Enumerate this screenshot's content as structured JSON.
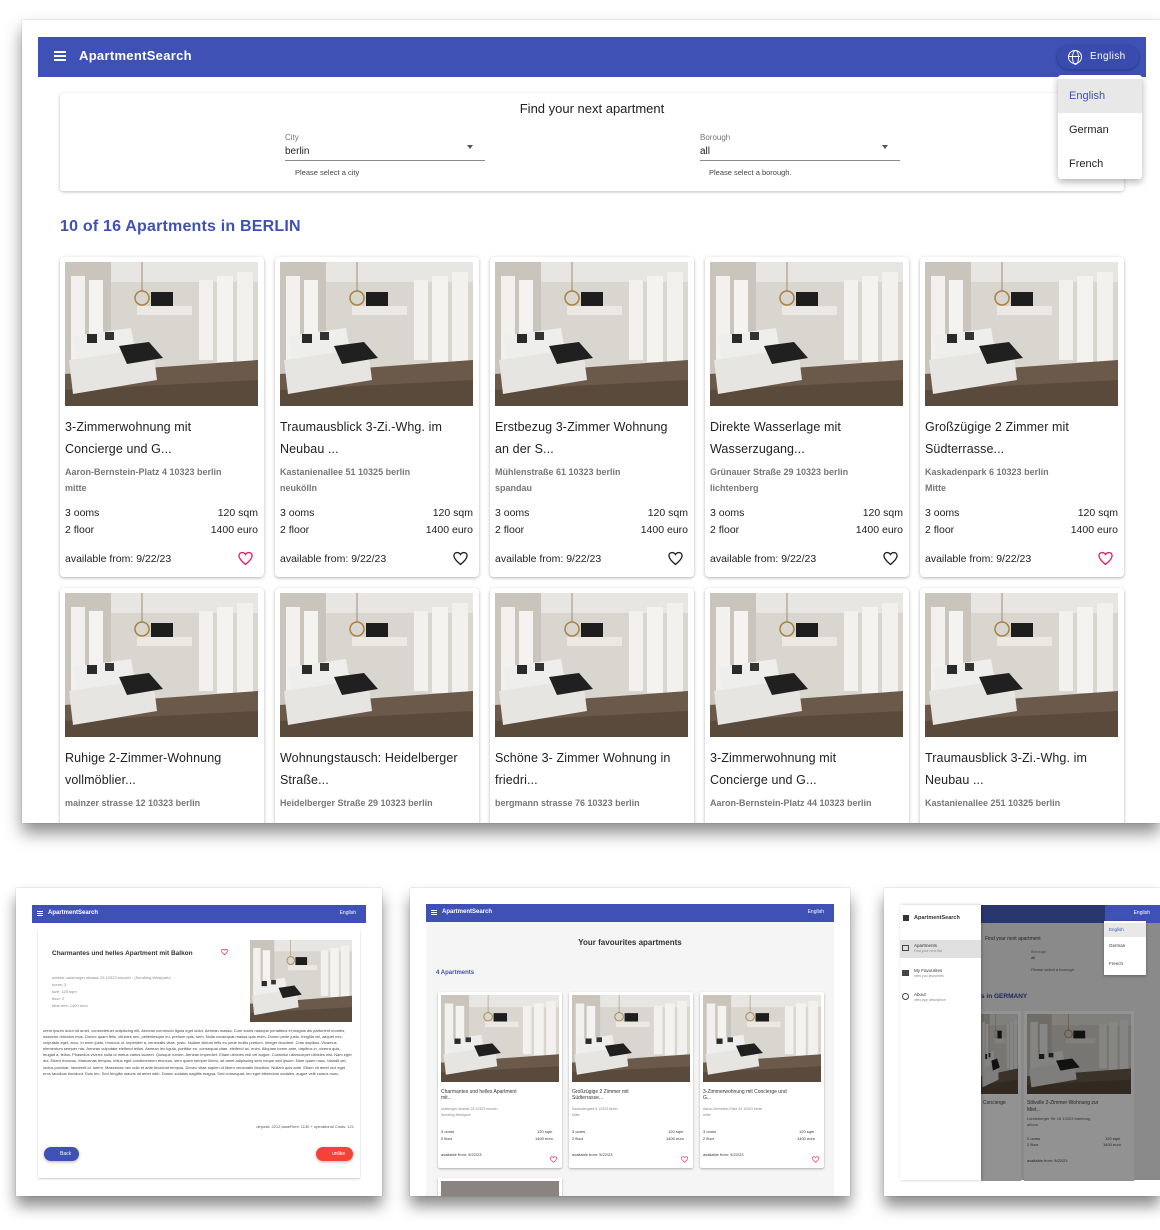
{
  "app": {
    "title": "ApartmentSearch"
  },
  "language": {
    "current": "English",
    "options": [
      "English",
      "German",
      "French"
    ]
  },
  "search": {
    "title": "Find your next apartment",
    "city": {
      "label": "City",
      "value": "berlin",
      "hint": "Please select a city"
    },
    "borough": {
      "label": "Borough",
      "value": "all",
      "hint": "Please select a borough."
    }
  },
  "results_title": "10 of 16 Apartments in BERLIN",
  "apartments": [
    {
      "title_1": "3-Zimmerwohnung mit",
      "title_2": "Concierge und G...",
      "address": "Aaron-Bernstein-Platz 4 10323 berlin",
      "borough": "mitte",
      "rooms": "3 ooms",
      "size": "120 sqm",
      "floor": "2 floor",
      "price": "1400 euro",
      "available": "available from: 9/22/23",
      "favourite": true
    },
    {
      "title_1": "Traumausblick 3-Zi.-Whg. im",
      "title_2": "Neubau ...",
      "address": "Kastanienallee 51 10325 berlin",
      "borough": "neukölln",
      "rooms": "3 ooms",
      "size": "120 sqm",
      "floor": "2 floor",
      "price": "1400 euro",
      "available": "available from: 9/22/23",
      "favourite": false
    },
    {
      "title_1": "Erstbezug 3-Zimmer Wohnung",
      "title_2": "an der S...",
      "address": "Mühlenstraße 61 10323 berlin",
      "borough": "spandau",
      "rooms": "3 ooms",
      "size": "120 sqm",
      "floor": "2 floor",
      "price": "1400 euro",
      "available": "available from: 9/22/23",
      "favourite": false
    },
    {
      "title_1": "Direkte Wasserlage mit",
      "title_2": "Wasserzugang...",
      "address": "Grünauer Straße 29 10323 berlin",
      "borough": "lichtenberg",
      "rooms": "3 ooms",
      "size": "120 sqm",
      "floor": "2 floor",
      "price": "1400 euro",
      "available": "available from: 9/22/23",
      "favourite": false
    },
    {
      "title_1": "Großzügige 2 Zimmer mit",
      "title_2": "Südterrasse...",
      "address": "Kaskadenpark 6 10323 berlin",
      "borough": "Mitte",
      "rooms": "3 ooms",
      "size": "120 sqm",
      "floor": "2 floor",
      "price": "1400 euro",
      "available": "available from: 9/22/23",
      "favourite": true
    },
    {
      "title_1": "Ruhige 2-Zimmer-Wohnung",
      "title_2": "vollmöblier...",
      "address": "mainzer strasse 12 10323 berlin"
    },
    {
      "title_1": "Wohnungstausch: Heidelberger",
      "title_2": "Straße...",
      "address": "Heidelberger Straße 29 10323 berlin"
    },
    {
      "title_1": "Schöne 3- Zimmer Wohnung in",
      "title_2": "friedri...",
      "address": "bergmann strasse 76 10323 berlin"
    },
    {
      "title_1": "3-Zimmerwohnung mit",
      "title_2": "Concierge und G...",
      "address": "Aaron-Bernstein-Platz 44 10323 berlin"
    },
    {
      "title_1": "Traumausblick 3-Zi.-Whg. im",
      "title_2": "Neubau ...",
      "address": "Kastanienallee 251 10325 berlin"
    }
  ],
  "detail": {
    "title": "Charmantes und helles Apartment mit Balkon",
    "address": "adress: salzburger strasse 23 10323 munich - (Sendling-Westpark)",
    "rooms": "ooms: 3",
    "size": "size: 120 sqm",
    "floor": "floor: 2",
    "total_rent": "total rent: 1400 euro",
    "description": "orem ipsum dolor sit amet, consectetuer adipiscing elit. Aenean commodo ligula eget dolor. Aenean massa. Cum sociis natoque penatibus et magnis dis parturient montes, nascetur ridiculus mus. Donec quam felis, ultricies nec, pellentesque eu, pretium quis, sem. Nulla consequat massa quis enim. Donec pede justo, fringilla vel, aliquet nec, vulputate eget, arcu. In enim justo, rhoncus ut, imperdiet a, venenatis vitae, justo. Nullam dictum felis eu pede mollis pretium. Integer tincidunt. Cras dapibus. Vivamus elementum semper nisi. Aenean vulputate eleifend tellus. Aenean leo ligula, porttitor eu, consequat vitae, eleifend ac, enim. Aliquam lorem ante, dapibus in, viverra quis, feugiat a, tellus. Phasellus viverra nulla ut metus varius laoreet. Quisque rutrum. Aenean imperdiet. Etiam ultricies nisi vel augue. Curabitur ullamcorper ultricies nisi. Nam eget dui. Etiam rhoncus. Maecenas tempus, tellus eget condimentum rhoncus, sem quam semper libero, sit amet adipiscing sem neque sed ipsum. Nam quam nunc, blandit vel, luctus pulvinar, hendrerit id, lorem. Maecenas nec odio et ante tincidunt tempus. Donec vitae sapien ut libero venenatis faucibus. Nullam quis ante. Etiam sit amet orci eget eros faucibus tincidunt. Duis leo. Sed fringilla mauris sit amet nibh. Donec sodales sagittis magna. Sed consequat, leo eget bibendum sodales, augue velit cursus nunc,",
    "costs": "deposit: 2212,baseRent: 1130 + operational Costs: 121",
    "back_label": "Back",
    "unlike_label": "unlike"
  },
  "favourites": {
    "title": "Your favourites apartments",
    "count": "4 Apartments",
    "cards": [
      {
        "title_1": "Charmantes und helles Apartment",
        "title_2": "mit...",
        "address": "salzburger strasse 23 10323 munich",
        "borough": "Sendling-Westpark",
        "rooms": "3 ooms",
        "size": "120 sqm",
        "floor": "2 floor",
        "price": "1400 euro",
        "available": "available from: 9/22/23"
      },
      {
        "title_1": "Großzügige 2 Zimmer mit",
        "title_2": "Südterrasse...",
        "address": "Kaskadenpark 6 10323 berlin",
        "borough": "Mitte",
        "rooms": "3 ooms",
        "size": "120 sqm",
        "floor": "2 floor",
        "price": "1400 euro",
        "available": "available from: 9/22/23"
      },
      {
        "title_1": "3-Zimmerwohnung mit Concierge und",
        "title_2": "G...",
        "address": "Aaron-Bernstein-Platz 44 10323 berlin",
        "borough": "mitte",
        "rooms": "3 ooms",
        "size": "120 sqm",
        "floor": "2 floor",
        "price": "1400 euro",
        "available": "available from: 9/22/23"
      }
    ]
  },
  "drawer": {
    "title": "ApartmentSearch",
    "items": [
      {
        "label": "Apartments",
        "sub": "Find your next flat"
      },
      {
        "label": "My Favourites",
        "sub": "view you favourites"
      },
      {
        "label": "About",
        "sub": "view app description"
      }
    ],
    "bg_search_title": "Find your next apartment",
    "bg_borough_label": "Borough",
    "bg_borough_value": "all",
    "bg_hint": "Please select a borough",
    "bg_results": "s in GERMANY",
    "bg_card_1": "Concierge",
    "bg_card_2": "Stilvolle 2-Zimmer-Wohnung zur",
    "bg_card_2b": "Miet...",
    "bg_card_2_addr": "Landsberger Str 16 10323 hamburg",
    "bg_card_2_borough": "altona",
    "bg_rooms": "2 ooms",
    "bg_floor": "2 floor",
    "bg_size": "120 sqm",
    "bg_price": "1400 euro",
    "bg_available": "available from: 9/22/23"
  },
  "colors": {
    "primary": "#3f51b5",
    "favourite": "#e91e63",
    "warn": "#f44336"
  }
}
